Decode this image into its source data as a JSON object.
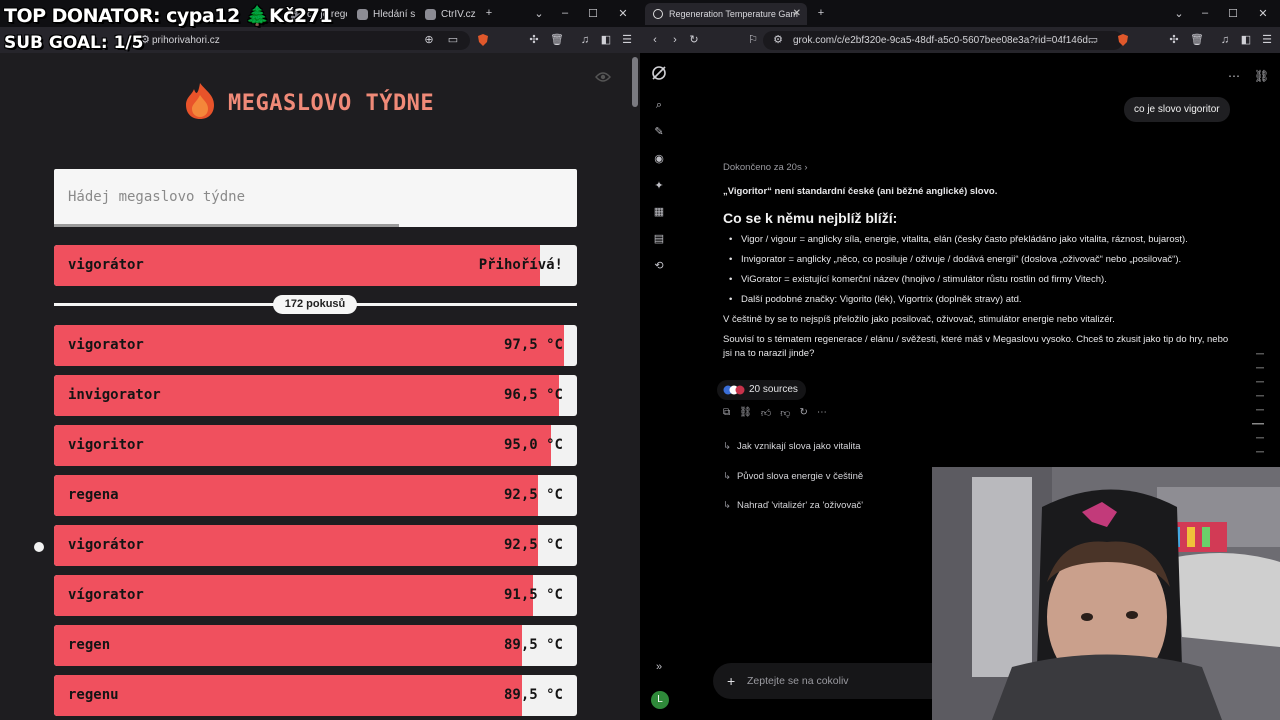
{
  "stream_overlay": {
    "top_donator": "TOP DONATOR: cypa12 🌲Kč271",
    "sub_goal": "SUB GOAL: 1/5"
  },
  "left_browser": {
    "tabs": [
      "co je rege",
      "Hledání s",
      "CtrIV.cz |"
    ],
    "url": "prihorivahori.cz",
    "window_controls": [
      "–",
      "☐",
      "✕"
    ]
  },
  "game": {
    "title": "MEGASLOVO TÝDNE",
    "placeholder": "Hádej megaslovo týdne",
    "input_progress": 0.66,
    "current": {
      "word": "vigorátor",
      "status": "Přihořívá!",
      "fill": 0.93
    },
    "tries_label": "172 pokusů",
    "guesses": [
      {
        "word": "vigorator",
        "temp": "97,5 °C",
        "fill": 0.975
      },
      {
        "word": "invigorator",
        "temp": "96,5 °C",
        "fill": 0.965
      },
      {
        "word": "vigoritor",
        "temp": "95,0 °C",
        "fill": 0.95
      },
      {
        "word": "regena",
        "temp": "92,5 °C",
        "fill": 0.925
      },
      {
        "word": "vigorátor",
        "temp": "92,5 °C",
        "fill": 0.925
      },
      {
        "word": "vígorator",
        "temp": "91,5 °C",
        "fill": 0.915
      },
      {
        "word": "regen",
        "temp": "89,5 °C",
        "fill": 0.895
      },
      {
        "word": "regenu",
        "temp": "89,5 °C",
        "fill": 0.895
      }
    ]
  },
  "right_browser": {
    "tab_title": "Regeneration Temperature Gam",
    "url": "grok.com/c/e2bf320e-9ca5-48df-a5c0-5607bee08e3a?rid=04f146d..."
  },
  "grok": {
    "user_message": "co je slovo vigoritor",
    "thought": "Dokončeno za 20s",
    "lead": "„Vigoritor“ není standardní české (ani běžné anglické) slovo.",
    "heading": "Co se k němu nejblíž blíží:",
    "bullets": [
      "Vigor / vigour = anglicky síla, energie, vitalita, elán (česky často překládáno jako vitalita, ráznost, bujarost).",
      "Invigorator = anglicky „něco, co posiluje / oživuje / dodává energii“ (doslova „oživovač“ nebo „posilovač“).",
      "ViGorator = existující komerční název (hnojivo / stimulátor růstu rostlin od firmy Vitech).",
      "Další podobné značky: Vigorito (lék), Vigortrix (doplněk stravy) atd."
    ],
    "para1": "V češtině by se to nejspíš přeložilo jako posilovač, oživovač, stimulátor energie nebo vitalizér.",
    "para2": "Souvisí to s tématem regenerace / elánu / svěžesti, které máš v Megaslovu vysoko. Chceš to zkusit jako tip do hry, nebo jsi na to narazil jinde?",
    "sources": "20 sources",
    "followups": [
      "Jak vznikají slova jako vitalita",
      "Původ slova energie v češtině",
      "Nahraď 'vitalizér' za 'oživovač'"
    ],
    "ask_placeholder": "Zeptejte se na cokoliv",
    "avatar_letter": "L"
  },
  "colors": {
    "fill_red": "#f0505e",
    "title_orange": "#f08a78"
  }
}
